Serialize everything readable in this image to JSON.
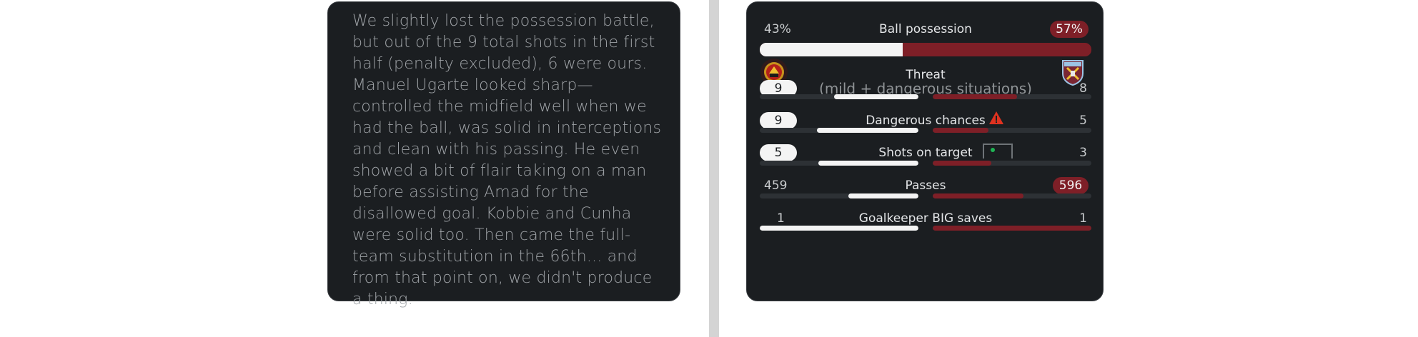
{
  "summary": {
    "text": "We slightly lost the possession battle, but out of the 9 total shots in the first half (penalty excluded), 6 were ours. Manuel Ugarte looked sharp—controlled the midfield well when we had the ball, was solid in interceptions and clean with his passing. He even showed a bit of flair taking on a man before assisting Amad for the disallowed goal. Kobbie and Cunha were solid too. Then came the full-team substitution in the 66th... and from that point on, we didn't produce a thing."
  },
  "teams": {
    "home_crest_icon": "manchester-united-crest-icon",
    "away_crest_icon": "west-ham-crest-icon"
  },
  "stats": {
    "possession": {
      "label": "Ball possession",
      "home": "43%",
      "away": "57%",
      "home_fraction": 0.43
    },
    "threat": {
      "label": "Threat",
      "sublabel": "(mild + dangerous situations)",
      "home": "9",
      "away": "8",
      "home_fraction": 0.53,
      "away_fraction": 0.53
    },
    "dangerous_chances": {
      "label": "Dangerous chances",
      "icon": "warning-icon",
      "home": "9",
      "away": "5",
      "home_fraction": 0.64,
      "away_fraction": 0.35
    },
    "shots_on_target": {
      "label": "Shots on target",
      "icon": "goal-frame-icon",
      "home": "5",
      "away": "3",
      "home_fraction": 0.63,
      "away_fraction": 0.37
    },
    "passes": {
      "label": "Passes",
      "home": "459",
      "away": "596",
      "home_fraction": 0.44,
      "away_fraction": 0.57
    },
    "gk_saves": {
      "label": "Goalkeeper BIG saves",
      "home": "1",
      "away": "1",
      "home_fraction": 1.0,
      "away_fraction": 1.0
    }
  },
  "colors": {
    "card_bg": "#1b1e21",
    "home_color": "#f4f4f4",
    "away_color": "#7e1f27",
    "warning": "#e0321f",
    "goal_dot": "#1fb454"
  }
}
